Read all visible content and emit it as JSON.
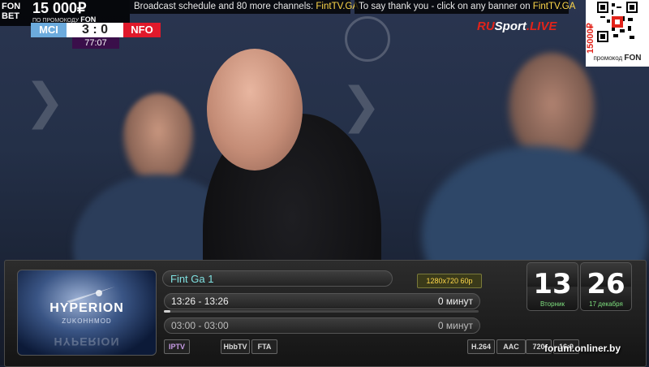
{
  "top_bar": {
    "broadcast_prefix": "Broadcast schedule and 80 more channels:",
    "broadcast_link": "FintTV.GA",
    "thanks_prefix": "To say thank you - click on any banner on",
    "thanks_link": "FintTV.GA"
  },
  "fon_banner": {
    "logo_top": "FON",
    "logo_bottom": "BET",
    "amount": "15 000₽",
    "promo_label": "ПО ПРОМОКОДУ",
    "promo_code": "FON"
  },
  "score_bug": {
    "home_team": "MCI",
    "score": "3 : 0",
    "away_team": "NFO",
    "match_clock": "77:07"
  },
  "rusport": {
    "ru": "RU",
    "sport": "Sport",
    "live": ".LIVE"
  },
  "qr_banner": {
    "vertical_text": "15000₽",
    "caption_prefix": "промокод",
    "caption_code": "FON"
  },
  "osd": {
    "picon_name": "HYPERION",
    "picon_sub": "ZUKOHHMOD",
    "channel_name": "Fint Ga 1",
    "resolution": "1280x720 60p",
    "events": [
      {
        "time": "13:26 - 13:26",
        "duration": "0 минут"
      },
      {
        "time": "03:00 - 03:00",
        "duration": "0 минут"
      }
    ],
    "event_progress": 0.02,
    "badges_left": [
      "IPTV",
      "HbbTV",
      "FTA"
    ],
    "badges_right": [
      "H.264",
      "AAC",
      "720",
      "16:9"
    ],
    "clock_hour": "13",
    "clock_minute": "26",
    "clock_weekday": "Вторник",
    "clock_date": "17 декабря"
  },
  "watermark": "forum.onliner.by"
}
